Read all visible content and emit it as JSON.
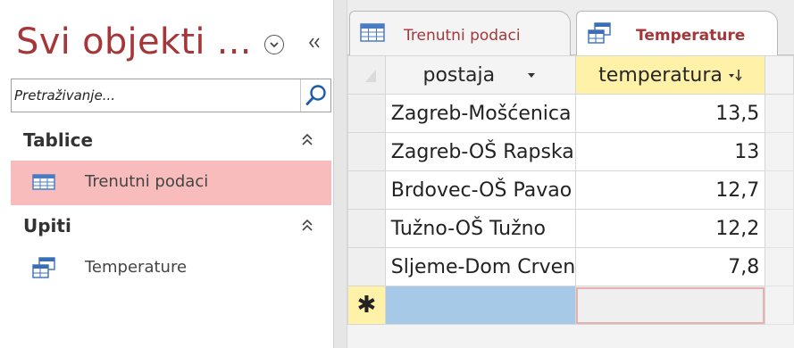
{
  "nav": {
    "title": "Svi objekti ...",
    "search_placeholder": "Pretraživanje...",
    "groups": [
      {
        "label": "Tablice",
        "items": [
          {
            "label": "Trenutni podaci",
            "icon": "table-icon",
            "selected": true
          }
        ]
      },
      {
        "label": "Upiti",
        "items": [
          {
            "label": "Temperature",
            "icon": "query-icon",
            "selected": false
          }
        ]
      }
    ]
  },
  "tabs": [
    {
      "label": "Trenutni podaci",
      "icon": "table-icon",
      "active": false
    },
    {
      "label": "Temperature",
      "icon": "query-icon",
      "active": true
    }
  ],
  "datasheet": {
    "columns": [
      {
        "label": "postaja",
        "indicator": "dropdown-arrow-icon"
      },
      {
        "label": "temperatura",
        "indicator": "sort-descending-icon"
      }
    ],
    "rows": [
      {
        "postaja": "Zagreb-Mošćenica",
        "temperatura": "13,5"
      },
      {
        "postaja": "Zagreb-OŠ Rapska",
        "temperatura": "13"
      },
      {
        "postaja": "Brdovec-OŠ Pavao",
        "temperatura": "12,7"
      },
      {
        "postaja": "Tužno-OŠ Tužno",
        "temperatura": "12,2"
      },
      {
        "postaja": "Sljeme-Dom Crvenog",
        "temperatura": "7,8"
      }
    ],
    "new_row_marker": "✱"
  },
  "colors": {
    "accent": "#a4373a",
    "selected_nav": "#f8bcbc",
    "sorted_header": "#fff2a8",
    "new_row": "#a7c9e8"
  }
}
